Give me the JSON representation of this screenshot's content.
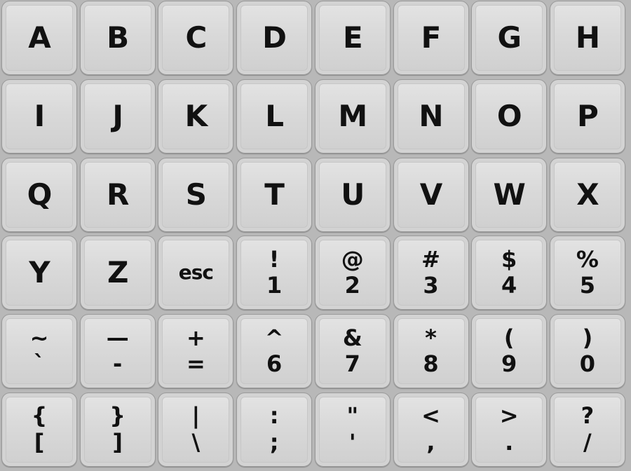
{
  "keyboard": {
    "rows": [
      [
        {
          "main": "A"
        },
        {
          "main": "B"
        },
        {
          "main": "C"
        },
        {
          "main": "D"
        },
        {
          "main": "E"
        },
        {
          "main": "F"
        },
        {
          "main": "G"
        },
        {
          "main": "H"
        }
      ],
      [
        {
          "main": "I"
        },
        {
          "main": "J"
        },
        {
          "main": "K"
        },
        {
          "main": "L"
        },
        {
          "main": "M"
        },
        {
          "main": "N"
        },
        {
          "main": "O"
        },
        {
          "main": "P"
        }
      ],
      [
        {
          "main": "Q"
        },
        {
          "main": "R"
        },
        {
          "main": "S"
        },
        {
          "main": "T"
        },
        {
          "main": "U"
        },
        {
          "main": "V"
        },
        {
          "main": "W"
        },
        {
          "main": "X"
        }
      ],
      [
        {
          "main": "Y"
        },
        {
          "main": "Z"
        },
        {
          "word": "esc"
        },
        {
          "top": "!",
          "bottom": "1"
        },
        {
          "top": "@",
          "bottom": "2"
        },
        {
          "top": "#",
          "bottom": "3"
        },
        {
          "top": "$",
          "bottom": "4"
        },
        {
          "top": "%",
          "bottom": "5"
        }
      ],
      [
        {
          "top": "~",
          "bottom": "`"
        },
        {
          "top": "—",
          "bottom": "-"
        },
        {
          "top": "+",
          "bottom": "="
        },
        {
          "top": "^",
          "bottom": "6"
        },
        {
          "top": "&",
          "bottom": "7"
        },
        {
          "top": "*",
          "bottom": "8"
        },
        {
          "top": "(",
          "bottom": "9"
        },
        {
          "top": ")",
          "bottom": "0"
        }
      ],
      [
        {
          "top": "{",
          "bottom": "["
        },
        {
          "top": "}",
          "bottom": "]"
        },
        {
          "top": "|",
          "bottom": "\\"
        },
        {
          "top": ":",
          "bottom": ";"
        },
        {
          "top": "\"",
          "bottom": "'"
        },
        {
          "top": "<",
          "bottom": ","
        },
        {
          "top": ">",
          "bottom": "."
        },
        {
          "top": "?",
          "bottom": "/"
        }
      ]
    ]
  }
}
